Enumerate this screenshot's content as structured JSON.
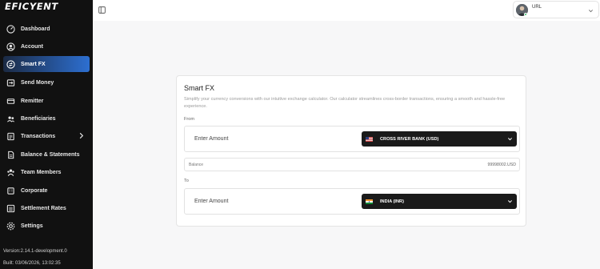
{
  "sidebar": {
    "logo": "EFICYENT",
    "items": [
      {
        "label": "Dashboard",
        "icon": "dashboard-icon"
      },
      {
        "label": "Account",
        "icon": "account-icon"
      },
      {
        "label": "Smart FX",
        "icon": "exchange-icon",
        "active": true
      },
      {
        "label": "Send Money",
        "icon": "send-icon"
      },
      {
        "label": "Remitter",
        "icon": "remitter-icon"
      },
      {
        "label": "Beneficiaries",
        "icon": "beneficiaries-icon"
      },
      {
        "label": "Transactions",
        "icon": "transactions-icon",
        "expandable": true
      },
      {
        "label": "Balance & Statements",
        "icon": "statement-icon"
      },
      {
        "label": "Team Members",
        "icon": "team-icon"
      },
      {
        "label": "Corporate",
        "icon": "corporate-icon"
      },
      {
        "label": "Settlement Rates",
        "icon": "rates-icon"
      },
      {
        "label": "Settings",
        "icon": "settings-icon"
      }
    ],
    "version": "Version:2.14.1-development.0",
    "build": "Built: 03/06/2026, 13:02:35"
  },
  "topbar": {
    "user_label": "URL"
  },
  "smart_fx": {
    "title": "Smart FX",
    "description": "Simplify your currency conversions with our intuitive exchange calculator. Our calculator streamlines cross-border transactions, ensuring a smooth and hassle-free experience.",
    "from_label": "From",
    "to_label": "To",
    "from_amount_placeholder": "Enter Amount",
    "to_amount_placeholder": "Enter Amount",
    "from_currency": "CROSS RIVER BANK (USD)",
    "to_currency": "INDIA (INR)",
    "balance_label": "Balance",
    "balance_value": "99998002.USD"
  },
  "colors": {
    "sidebar_bg": "#111111",
    "active_start": "#1b2a44",
    "active_end": "#2d6fd1",
    "select_bg": "#1a1a1a",
    "status_online": "#39c36b"
  }
}
